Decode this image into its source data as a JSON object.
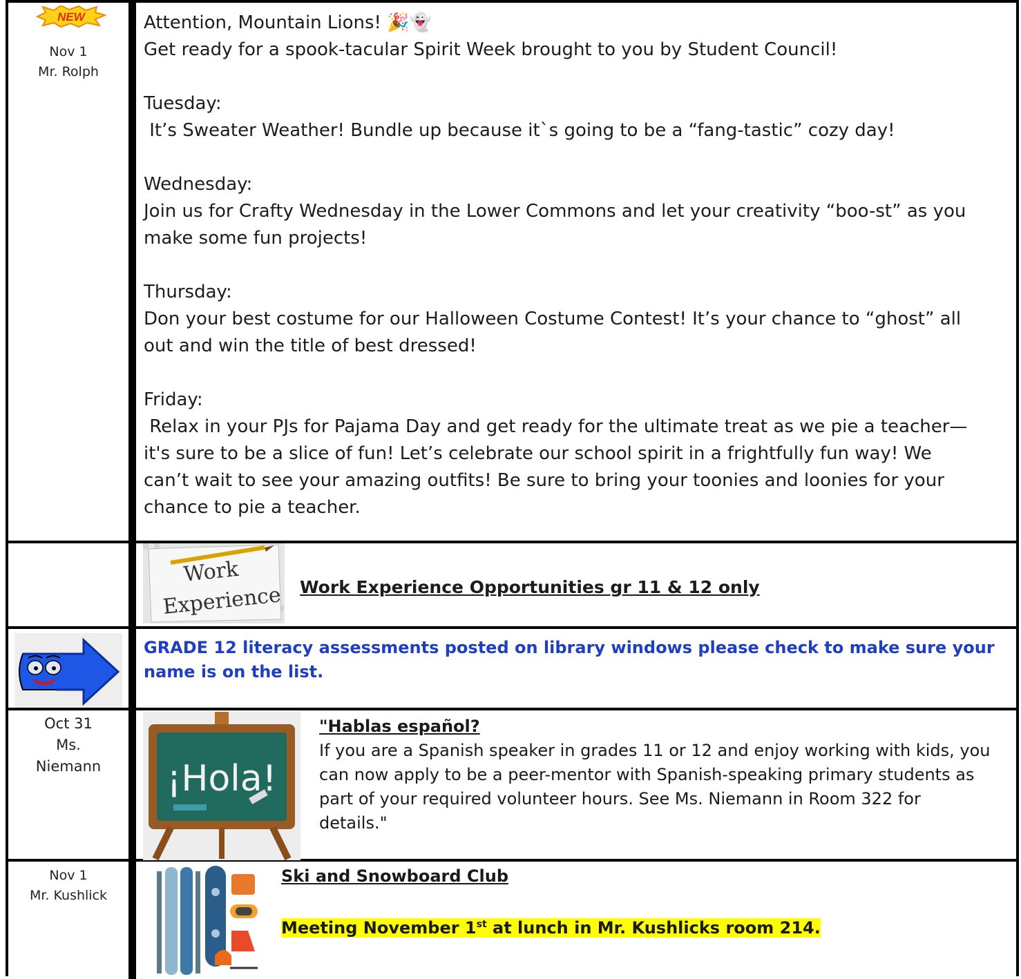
{
  "row1": {
    "badge": "NEW",
    "date": "Nov 1",
    "author": "Mr. Rolph",
    "lines": [
      "Attention, Mountain Lions! 🎉👻",
      "Get ready for a spook-tacular Spirit Week brought to you by Student Council!",
      "",
      "Tuesday:",
      " It’s Sweater Weather! Bundle up because it`s going to be a “fang-tastic” cozy day!",
      "",
      "Wednesday:",
      "Join us for Crafty Wednesday in the Lower Commons and let your creativity “boo-st” as you",
      "make some fun projects!",
      "",
      "Thursday:",
      "Don your best costume for our Halloween Costume Contest! It’s your chance to “ghost” all",
      "out and win the title of best dressed!",
      "",
      "Friday:",
      " Relax in your PJs for Pajama Day and get ready for the ultimate treat as we pie a teacher—",
      "it's sure to be a slice of fun! Let’s celebrate our school spirit in a frightfully fun way! We",
      "can’t wait to see your amazing outfits! Be sure to bring your toonies and loonies for your",
      "chance to pie a teacher."
    ]
  },
  "row2": {
    "image_text_1": "Work",
    "image_text_2": "Experience",
    "title": "Work Experience Opportunities gr 11 & 12 only"
  },
  "row3": {
    "text_line1": "GRADE 12 literacy assessments posted on library windows please check to make sure your",
    "text_line2": "name is on the list.",
    "color": "#1f3fc2"
  },
  "row4": {
    "date": "Oct 31",
    "author_line1": "Ms.",
    "author_line2": "Niemann",
    "image_text": "¡Hola!",
    "title": "\"Hablas español?",
    "lines": [
      "If you are a Spanish speaker in grades 11 or 12 and enjoy working with kids, you",
      "can now apply to be a peer-mentor with Spanish-speaking primary students as",
      "part of your required volunteer hours. See Ms. Niemann in Room 322 for",
      "details.\""
    ]
  },
  "row5": {
    "date": "Nov 1",
    "author": "Mr. Kushlick",
    "title": "Ski and Snowboard Club",
    "meeting_pre": "Meeting November 1",
    "meeting_sup": "st",
    "meeting_post": " at lunch in Mr. Kushlicks room 214."
  }
}
